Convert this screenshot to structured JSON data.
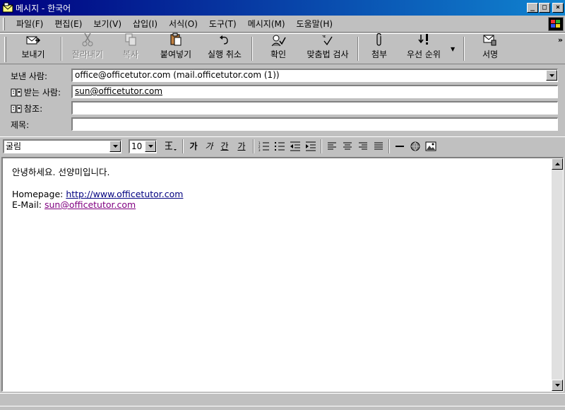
{
  "window": {
    "title": "메시지 - 한국어",
    "minimize": "_",
    "maximize": "□",
    "close": "×"
  },
  "menu": {
    "items": [
      {
        "label": "파일(F)"
      },
      {
        "label": "편집(E)"
      },
      {
        "label": "보기(V)"
      },
      {
        "label": "삽입(I)"
      },
      {
        "label": "서식(O)"
      },
      {
        "label": "도구(T)"
      },
      {
        "label": "메시지(M)"
      },
      {
        "label": "도움말(H)"
      }
    ]
  },
  "toolbar": {
    "send": "보내기",
    "cut": "잘라내기",
    "copy": "복사",
    "paste": "붙여넣기",
    "undo": "실행 취소",
    "check": "확인",
    "spelling": "맞춤법 검사",
    "attach": "첨부",
    "priority": "우선 순위",
    "signature": "서명",
    "more": "»"
  },
  "header": {
    "from_label": "보낸 사람:",
    "from_value": "office@officetutor.com     (mail.officetutor.com (1))",
    "to_label": "받는 사람:",
    "to_value": "sun@officetutor.com",
    "cc_label": "참조:",
    "cc_value": "",
    "subject_label": "제목:",
    "subject_value": ""
  },
  "format": {
    "font": "굴림",
    "size": "10",
    "bold": "가",
    "italic": "가",
    "underline": "간",
    "color": "가"
  },
  "body": {
    "greeting": "안녕하세요. 선양미입니다.",
    "homepage_label": "Homepage: ",
    "homepage_url": "http://www.officetutor.com",
    "email_label": "E-Mail: ",
    "email_value": "sun@officetutor.com"
  },
  "colors": {
    "titlebar_start": "#000080",
    "titlebar_end": "#1084d0",
    "face": "#c0c0c0",
    "link": "#000080",
    "visited_link": "#800080"
  }
}
